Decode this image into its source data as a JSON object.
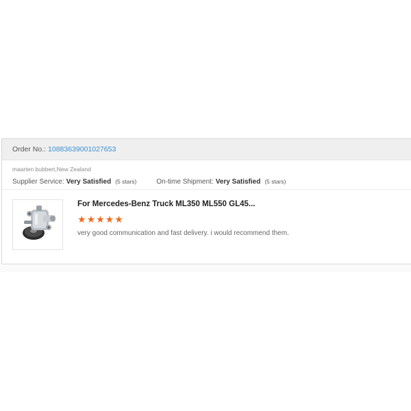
{
  "order": {
    "label": "Order No.:",
    "number": "10883639001027653"
  },
  "reviewer": {
    "name_location": "maarten bubbert,New Zealand"
  },
  "ratings": {
    "supplier_service": {
      "label": "Supplier Service:",
      "value": "Very Satisfied",
      "stars_text": "(5 stars)"
    },
    "shipment": {
      "label": "On-time Shipment:",
      "value": "Very Satisfied",
      "stars_text": "(5 stars)"
    }
  },
  "product": {
    "title": "For Mercedes-Benz Truck ML350 ML550 GL45...",
    "thumbnail_icon": "power-steering-pump-image",
    "rating": 5,
    "star_color": "#f06a1c"
  },
  "feedback": {
    "text": "very good communication and fast delivery. i would recommend them."
  },
  "colors": {
    "link": "#3d8fd0",
    "header_bg": "#efefef",
    "star": "#f06a1c"
  }
}
